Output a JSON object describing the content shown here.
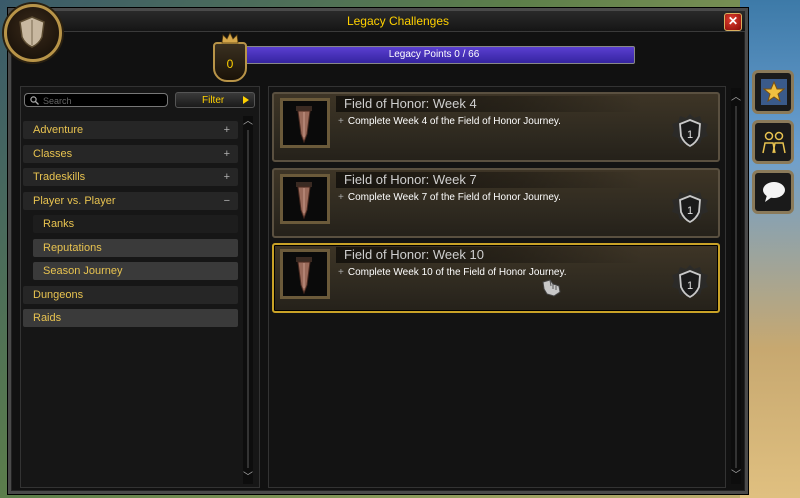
{
  "window": {
    "title": "Legacy Challenges",
    "close_glyph": "✕"
  },
  "points": {
    "badge_value": "0",
    "label": "Legacy Points 0 / 66",
    "current": 0,
    "max": 66
  },
  "search": {
    "placeholder": "Search"
  },
  "filter": {
    "label": "Filter"
  },
  "categories": [
    {
      "label": "Adventure",
      "sign": "+",
      "level": 0,
      "selected": false
    },
    {
      "label": "Classes",
      "sign": "+",
      "level": 0,
      "selected": false
    },
    {
      "label": "Tradeskills",
      "sign": "+",
      "level": 0,
      "selected": false
    },
    {
      "label": "Player vs. Player",
      "sign": "−",
      "level": 0,
      "selected": false
    },
    {
      "label": "Ranks",
      "sign": "",
      "level": 1,
      "selected": false
    },
    {
      "label": "Reputations",
      "sign": "",
      "level": 1,
      "selected": true
    },
    {
      "label": "Season Journey",
      "sign": "",
      "level": 1,
      "selected": true
    },
    {
      "label": "Dungeons",
      "sign": "",
      "level": 0,
      "selected": false
    },
    {
      "label": "Raids",
      "sign": "",
      "level": 0,
      "selected": true
    }
  ],
  "challenges": [
    {
      "title": "Field of Honor: Week 4",
      "description": "Complete Week 4 of the Field of Honor Journey.",
      "points": "1",
      "highlight": false
    },
    {
      "title": "Field of Honor: Week 7",
      "description": "Complete Week 7 of the Field of Honor Journey.",
      "points": "1",
      "highlight": false
    },
    {
      "title": "Field of Honor: Week 10",
      "description": "Complete Week 10 of the Field of Honor Journey.",
      "points": "1",
      "highlight": true
    }
  ],
  "icons": {
    "portrait": "shield-icon",
    "badge": "crown-icon",
    "challenge": "dagger-icon",
    "points": "shield-badge-icon",
    "side_tabs": [
      "star-icon",
      "party-icon",
      "chat-bubble-icon"
    ]
  },
  "colors": {
    "gold": "#ffd100",
    "bar": "#3524a0",
    "highlight_border": "#c9a227"
  }
}
